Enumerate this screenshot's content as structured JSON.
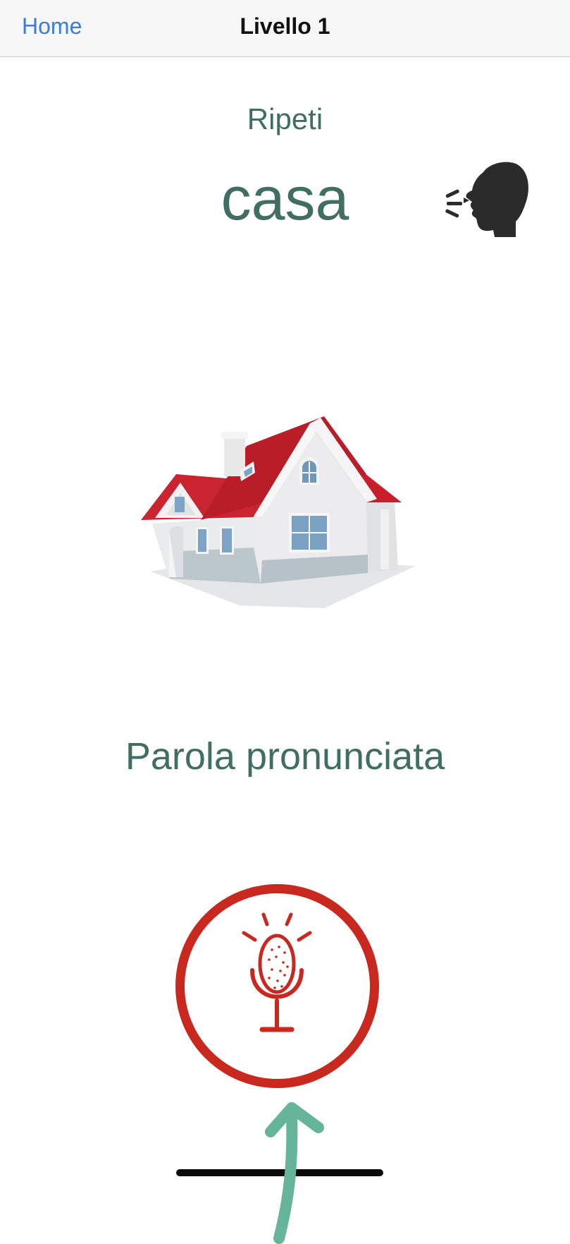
{
  "navbar": {
    "back_label": "Home",
    "title": "Livello 1",
    "back_color": "#3b7dd8"
  },
  "exercise": {
    "instruction": "Ripeti",
    "word": "casa",
    "picture_icon": "house-illustration",
    "speak_icon": "speaking-head-icon",
    "result_label": "Parola pronunciata",
    "text_color": "#416e63"
  },
  "controls": {
    "mic_icon": "microphone-icon",
    "mic_color": "#c8281e",
    "hint_arrow_color": "#66b59a"
  }
}
